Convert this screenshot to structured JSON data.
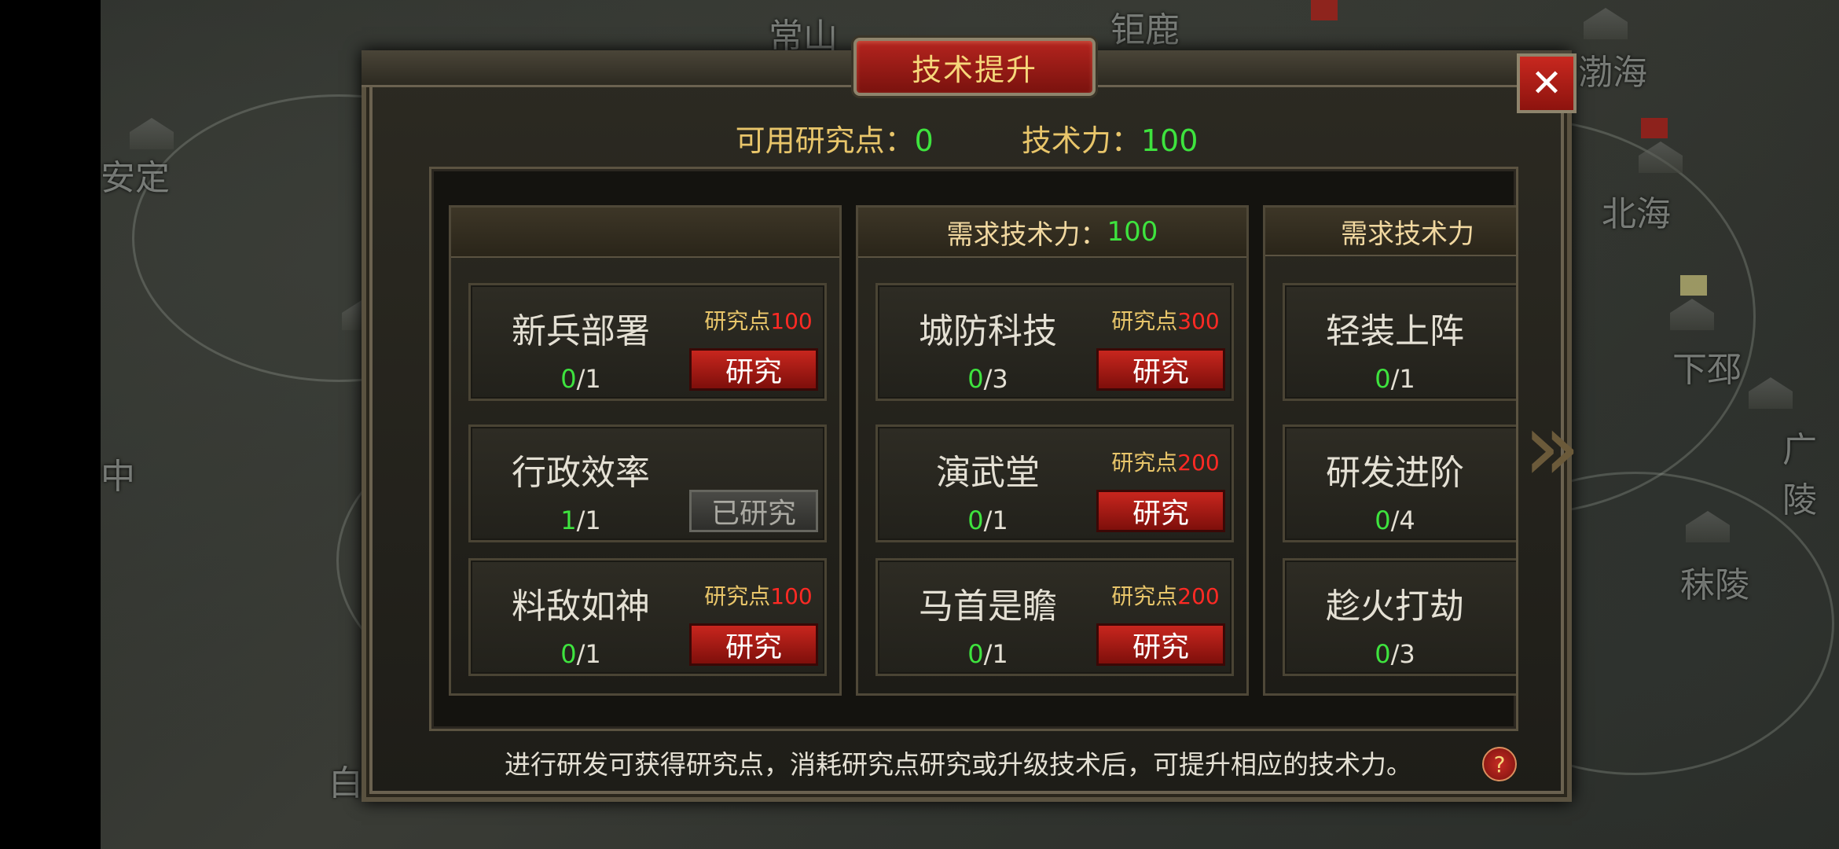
{
  "map": {
    "cities": [
      "常山",
      "钜鹿",
      "渤海",
      "安定",
      "北海",
      "下邳",
      "广陵",
      "秣陵",
      "中",
      "白"
    ]
  },
  "dialog": {
    "title": "技术提升",
    "close_icon": "✕",
    "summary": {
      "research_label": "可用研究点：",
      "research_value": "0",
      "power_label": "技术力：",
      "power_value": "100"
    },
    "columns": [
      {
        "header_label": "",
        "header_value": "",
        "cards": [
          {
            "name": "新兵部署",
            "done": "0",
            "total": "/1",
            "cost_label": "研究点",
            "cost_value": "100",
            "button": "研究",
            "researched": false
          },
          {
            "name": "行政效率",
            "done": "1",
            "total": "/1",
            "cost_label": "",
            "cost_value": "",
            "button": "已研究",
            "researched": true
          },
          {
            "name": "料敌如神",
            "done": "0",
            "total": "/1",
            "cost_label": "研究点",
            "cost_value": "100",
            "button": "研究",
            "researched": false
          }
        ]
      },
      {
        "header_label": "需求技术力：",
        "header_value": "100",
        "cards": [
          {
            "name": "城防科技",
            "done": "0",
            "total": "/3",
            "cost_label": "研究点",
            "cost_value": "300",
            "button": "研究",
            "researched": false
          },
          {
            "name": "演武堂",
            "done": "0",
            "total": "/1",
            "cost_label": "研究点",
            "cost_value": "200",
            "button": "研究",
            "researched": false
          },
          {
            "name": "马首是瞻",
            "done": "0",
            "total": "/1",
            "cost_label": "研究点",
            "cost_value": "200",
            "button": "研究",
            "researched": false
          }
        ]
      },
      {
        "header_label": "需求技术力",
        "header_value": "",
        "cards": [
          {
            "name": "轻装上阵",
            "done": "0",
            "total": "/1",
            "cost_label": "",
            "cost_value": "",
            "button": "",
            "researched": false
          },
          {
            "name": "研发进阶",
            "done": "0",
            "total": "/4",
            "cost_label": "",
            "cost_value": "",
            "button": "",
            "researched": false
          },
          {
            "name": "趁火打劫",
            "done": "0",
            "total": "/3",
            "cost_label": "",
            "cost_value": "",
            "button": "",
            "researched": false
          }
        ]
      }
    ],
    "next_arrow": "»",
    "footer": "进行研发可获得研究点，消耗研究点研究或升级技术后，可提升相应的技术力。",
    "help_icon": "?"
  },
  "colors": {
    "gold": "#e8c56a",
    "green": "#3ee33e",
    "red": "#ff2a24",
    "button_red": "#c8261e"
  }
}
